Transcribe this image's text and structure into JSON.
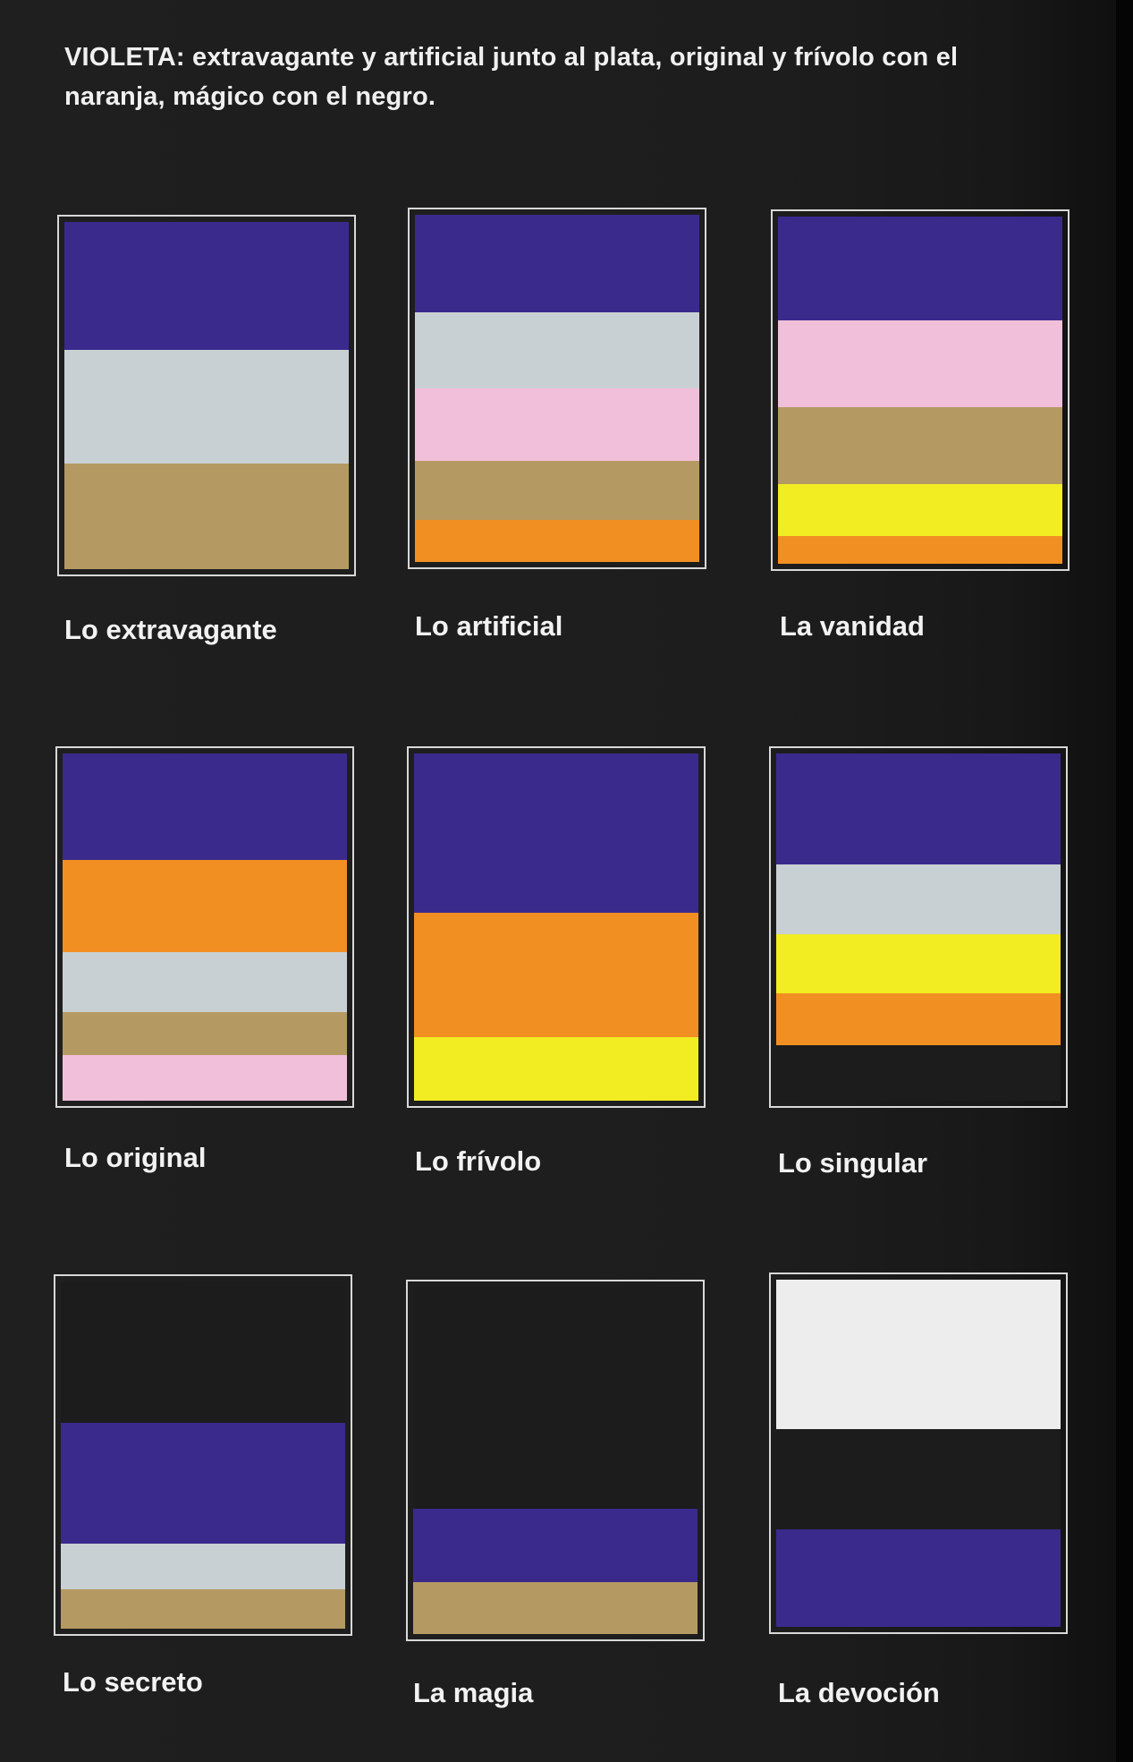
{
  "title": "VIOLETA: extravagante y artificial junto al plata, original y frívolo con el naranja, mágico con el negro.",
  "colors": {
    "violet": "#3a2a8c",
    "silver": "#c9d0d3",
    "gold": "#b49a62",
    "pink": "#f1bfd9",
    "orange": "#f28f22",
    "yellow": "#f2ec22",
    "black": "#1c1c1c",
    "white": "#ededed"
  },
  "swatches": [
    {
      "label": "Lo extravagante",
      "bands": [
        {
          "color": "violet",
          "weight": 34
        },
        {
          "color": "silver",
          "weight": 30
        },
        {
          "color": "gold",
          "weight": 28
        }
      ]
    },
    {
      "label": "Lo artificial",
      "bands": [
        {
          "color": "violet",
          "weight": 28
        },
        {
          "color": "silver",
          "weight": 22
        },
        {
          "color": "pink",
          "weight": 21
        },
        {
          "color": "gold",
          "weight": 17
        },
        {
          "color": "orange",
          "weight": 12
        }
      ]
    },
    {
      "label": "La vanidad",
      "bands": [
        {
          "color": "violet",
          "weight": 30
        },
        {
          "color": "pink",
          "weight": 25
        },
        {
          "color": "gold",
          "weight": 22
        },
        {
          "color": "yellow",
          "weight": 15
        },
        {
          "color": "orange",
          "weight": 8
        }
      ]
    },
    {
      "label": "Lo original",
      "bands": [
        {
          "color": "violet",
          "weight": 30
        },
        {
          "color": "orange",
          "weight": 26
        },
        {
          "color": "silver",
          "weight": 17
        },
        {
          "color": "gold",
          "weight": 12
        },
        {
          "color": "pink",
          "weight": 13
        }
      ]
    },
    {
      "label": "Lo frívolo",
      "bands": [
        {
          "color": "violet",
          "weight": 45
        },
        {
          "color": "orange",
          "weight": 35
        },
        {
          "color": "yellow",
          "weight": 18
        }
      ]
    },
    {
      "label": "Lo singular",
      "bands": [
        {
          "color": "violet",
          "weight": 32
        },
        {
          "color": "silver",
          "weight": 20
        },
        {
          "color": "yellow",
          "weight": 17
        },
        {
          "color": "orange",
          "weight": 15
        },
        {
          "color": "black",
          "weight": 16
        }
      ]
    },
    {
      "label": "Lo secreto",
      "bands": [
        {
          "color": "black",
          "weight": 40
        },
        {
          "color": "violet",
          "weight": 34
        },
        {
          "color": "silver",
          "weight": 13
        },
        {
          "color": "gold",
          "weight": 11
        }
      ]
    },
    {
      "label": "La magia",
      "bands": [
        {
          "color": "black",
          "weight": 64
        },
        {
          "color": "violet",
          "weight": 21
        },
        {
          "color": "gold",
          "weight": 15
        }
      ]
    },
    {
      "label": "La devoción",
      "bands": [
        {
          "color": "white",
          "weight": 43
        },
        {
          "color": "black",
          "weight": 29
        },
        {
          "color": "violet",
          "weight": 28
        }
      ]
    }
  ]
}
